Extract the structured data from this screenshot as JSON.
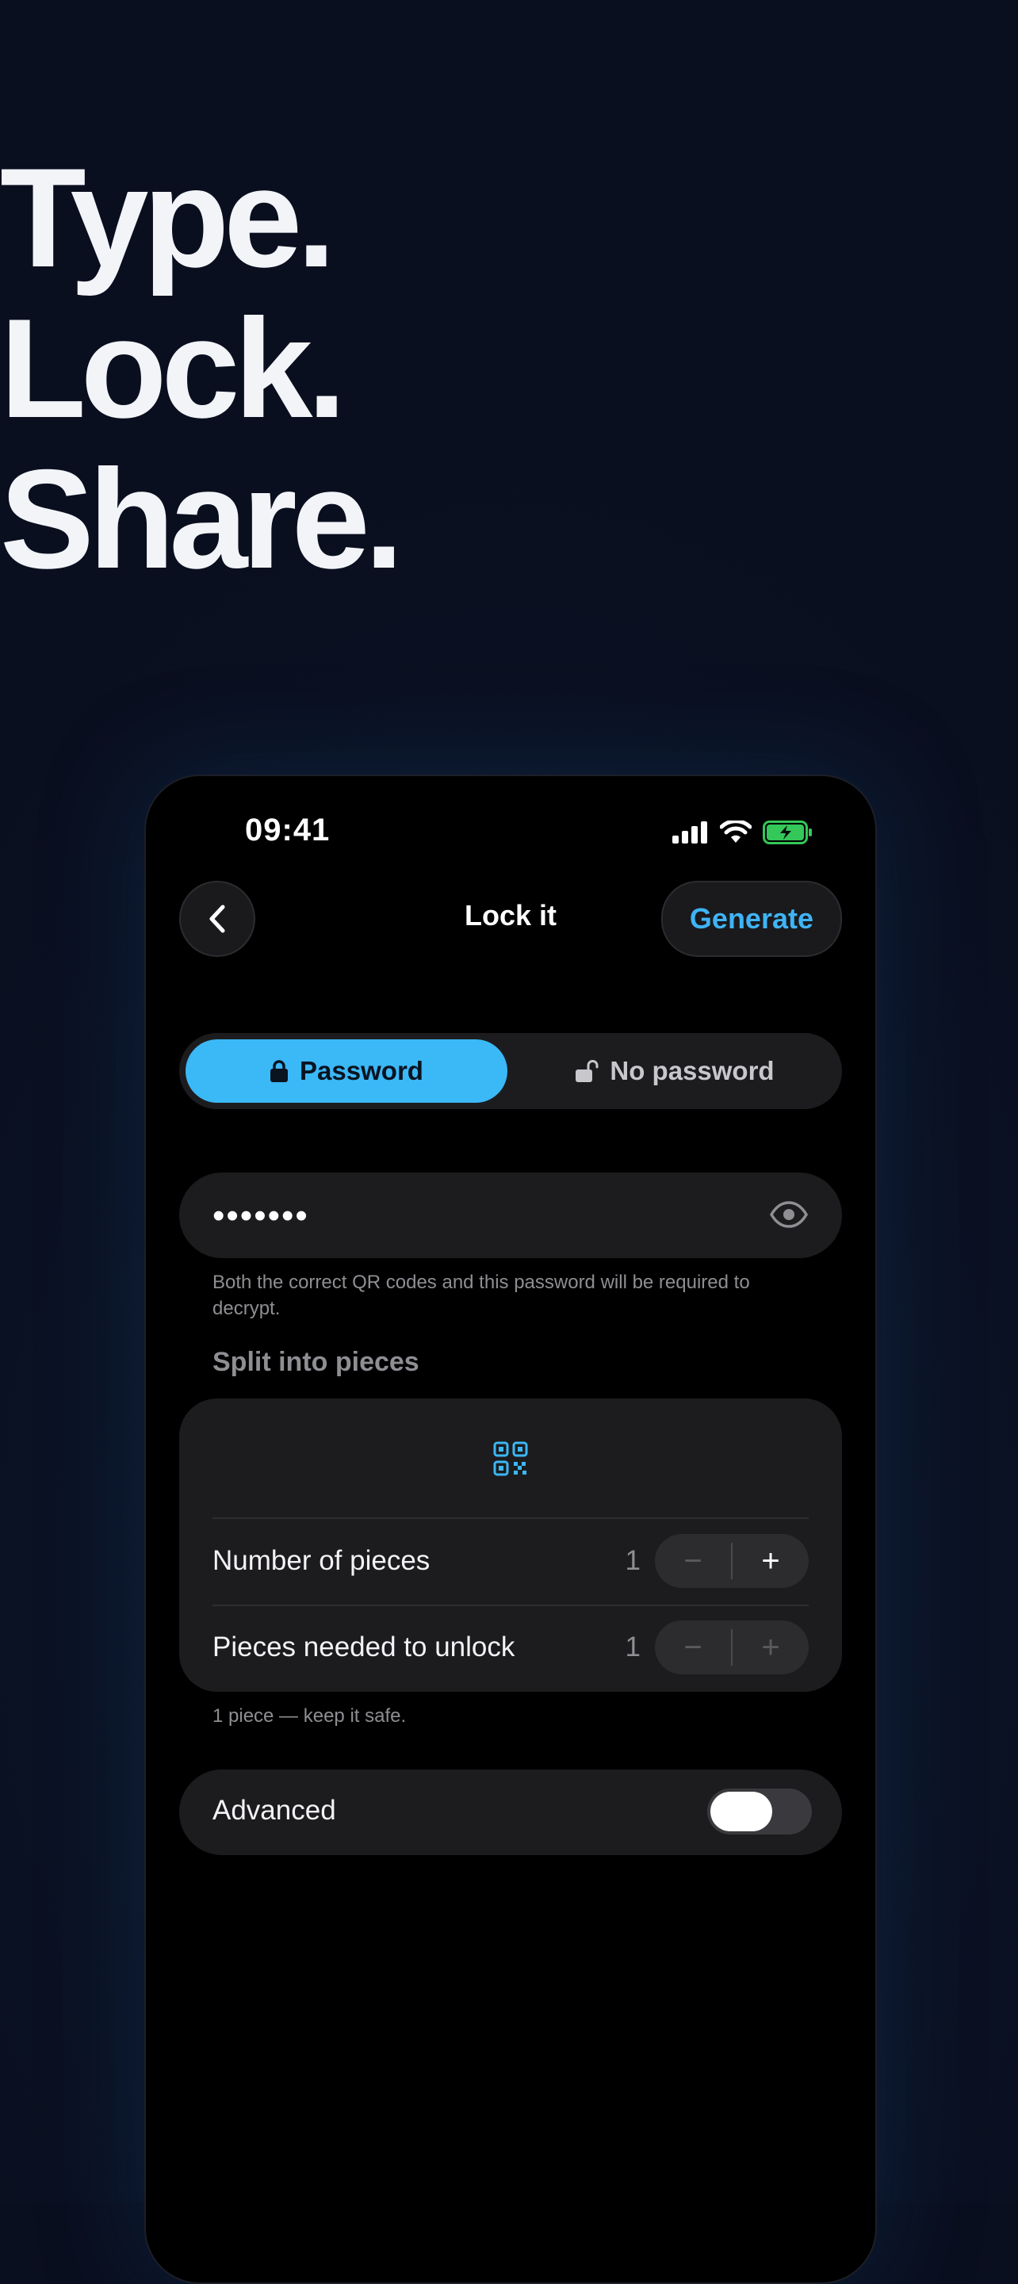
{
  "headline": {
    "line1": "Type.",
    "line2": "Lock.",
    "line3": "Share."
  },
  "status_bar": {
    "time": "09:41"
  },
  "nav": {
    "title": "Lock it",
    "generate_label": "Generate"
  },
  "mode_toggle": {
    "password_label": "Password",
    "no_password_label": "No password",
    "selected": "Password"
  },
  "password": {
    "masked_value": "•••••••",
    "hint": "Both the correct QR codes and this password will be required to decrypt."
  },
  "split": {
    "section_title": "Split into pieces",
    "rows": [
      {
        "label": "Number of pieces",
        "value": "1",
        "minus": "−",
        "plus": "+"
      },
      {
        "label": "Pieces needed to unlock",
        "value": "1",
        "minus": "−",
        "plus": "+"
      }
    ],
    "caption": "1 piece — keep it safe."
  },
  "advanced": {
    "label": "Advanced",
    "enabled": false
  },
  "colors": {
    "accent": "#3bb8f6",
    "card": "#1c1c1e",
    "battery": "#34c759"
  }
}
